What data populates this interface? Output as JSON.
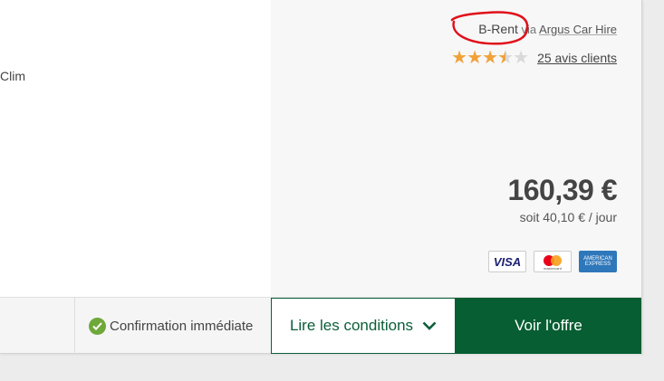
{
  "offer": {
    "feature_text": "Clim",
    "supplier_name": "B-Rent",
    "via_text": "via",
    "agency_name": "Argus Car Hire",
    "rating_stars": 3.5,
    "rating_max": 5,
    "reviews_link": "25 avis clients",
    "price": "160,39 €",
    "per_day": "soit 40,10 € / jour",
    "payments": [
      {
        "label": "VISA",
        "icon": "visa-icon"
      },
      {
        "label": "mastercard",
        "icon": "mastercard-icon"
      },
      {
        "label": "AMERICAN EXPRESS",
        "icon": "amex-icon"
      }
    ]
  },
  "footer": {
    "confirmation": "Confirmation immédiate",
    "conditions_button": "Lire les conditions",
    "offer_button": "Voir l'offre"
  },
  "colors": {
    "brand_green": "#065e32",
    "star_color": "#f0a23a",
    "annotation_red": "#e0101a"
  }
}
